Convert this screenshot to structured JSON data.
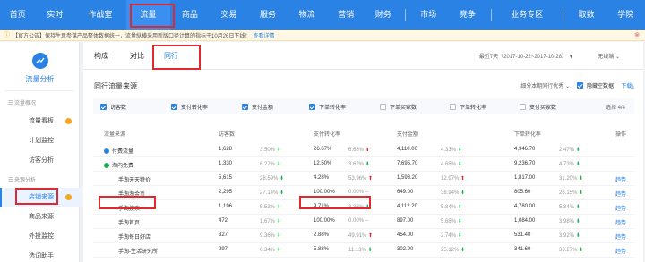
{
  "topnav": {
    "items": [
      "首页",
      "实时",
      "作战室",
      "流量",
      "商品",
      "交易",
      "服务",
      "物流",
      "营销",
      "财务",
      "市场",
      "竞争",
      "业务专区",
      "取数",
      "学院"
    ],
    "active": "流量"
  },
  "notice": {
    "icon": "warning-icon",
    "text": "【官方公告】保持生意参谋产品整体数据统一，流量纵横采用新版口径计算的指标于10月26日下线！",
    "link_label": "查看详情"
  },
  "sidebar": {
    "title": "流量分析",
    "group_overview": "流量概况",
    "items_top": [
      "流量看板",
      "计划监控",
      "访客分析"
    ],
    "group_source": "来源分析",
    "items_bottom": [
      "店铺来源",
      "商品来源",
      "外投监控",
      "选词助手"
    ],
    "active": "店铺来源"
  },
  "tabs": [
    "构成",
    "对比",
    "同行"
  ],
  "active_tab": "同行",
  "date_range": "最近7天（2017-10-22~2017-10-28）",
  "terminal": "无线端",
  "section_title": "同行流量来源",
  "column_setting": "细分本期同行优秀",
  "hide_empty_label": "隐藏空数据",
  "download_label": "下载",
  "metrics": [
    {
      "label": "访客数",
      "checked": true
    },
    {
      "label": "支付转化率",
      "checked": true
    },
    {
      "label": "支付金额",
      "checked": true
    },
    {
      "label": "下单转化率",
      "checked": true
    },
    {
      "label": "下单买家数",
      "checked": false
    },
    {
      "label": "下单转化率",
      "checked": false
    },
    {
      "label": "支付买家数",
      "checked": false
    }
  ],
  "metrics_selected": "选择 4/4",
  "table": {
    "headers": [
      "流量来源",
      "访客数",
      "支付转化率",
      "支付金额",
      "下单转化率",
      "操作"
    ],
    "rows": [
      {
        "name": "付费流量",
        "level": 0,
        "dot": "blue",
        "visitors": "1,628",
        "v_pct": "3.50%",
        "v_dir": "down",
        "conv": "26.67%",
        "c_pct": "6.68%",
        "c_dir": "up",
        "amount": "4,110.00",
        "a_pct": "4.33%",
        "a_dir": "down",
        "order": "4,946.70",
        "o_pct": "2.47%",
        "o_dir": "down",
        "action": ""
      },
      {
        "name": "淘内免费",
        "level": 0,
        "dot": "green",
        "visitors": "1,330",
        "v_pct": "6.27%",
        "v_dir": "down",
        "conv": "12.50%",
        "c_pct": "3.62%",
        "c_dir": "down",
        "amount": "7,695.70",
        "a_pct": "4.68%",
        "a_dir": "down",
        "order": "9,236.70",
        "o_pct": "4.73%",
        "o_dir": "down",
        "action": ""
      },
      {
        "name": "手淘天天特价",
        "level": 1,
        "visitors": "5,615",
        "v_pct": "28.59%",
        "v_dir": "down",
        "conv": "4.28%",
        "c_pct": "53.96%",
        "c_dir": "up",
        "amount": "1,593.20",
        "a_pct": "12.97%",
        "a_dir": "up",
        "order": "1,817.00",
        "o_pct": "31.20%",
        "o_dir": "down",
        "action": "趋势"
      },
      {
        "name": "手淘淘金币",
        "level": 1,
        "visitors": "2,295",
        "v_pct": "27.14%",
        "v_dir": "down",
        "conv": "100.00%",
        "c_pct": "0.00%",
        "c_dir": "none",
        "amount": "649.00",
        "a_pct": "38.94%",
        "a_dir": "down",
        "order": "805.60",
        "o_pct": "26.15%",
        "o_dir": "down",
        "action": "趋势"
      },
      {
        "name": "手淘搜索",
        "level": 1,
        "visitors": "1,196",
        "v_pct": "5.53%",
        "v_dir": "down",
        "conv": "9.71%",
        "c_pct": "3.38%",
        "c_dir": "down",
        "amount": "4,112.20",
        "a_pct": "5.84%",
        "a_dir": "down",
        "order": "4,780.00",
        "o_pct": "5.84%",
        "o_dir": "down",
        "action": "趋势"
      },
      {
        "name": "手淘首页",
        "level": 1,
        "visitors": "472",
        "v_pct": "1.67%",
        "v_dir": "down",
        "conv": "100.00%",
        "c_pct": "0.00%",
        "c_dir": "none",
        "amount": "897.00",
        "a_pct": "5.68%",
        "a_dir": "down",
        "order": "1,084.00",
        "o_pct": "3.98%",
        "o_dir": "down",
        "action": "趋势"
      },
      {
        "name": "手淘每日好店",
        "level": 1,
        "visitors": "327",
        "v_pct": "9.36%",
        "v_dir": "down",
        "conv": "2.88%",
        "c_pct": "49.91%",
        "c_dir": "up",
        "amount": "454.00",
        "a_pct": "2.74%",
        "a_dir": "down",
        "order": "531.40",
        "o_pct": "3.92%",
        "o_dir": "down",
        "action": "趋势"
      },
      {
        "name": "手淘-生活研究所",
        "level": 1,
        "visitors": "297",
        "v_pct": "0.34%",
        "v_dir": "down",
        "conv": "5.88%",
        "c_pct": "11.13%",
        "c_dir": "down",
        "amount": "302.90",
        "a_pct": "25.12%",
        "a_dir": "down",
        "order": "341.60",
        "o_pct": "36.27%",
        "o_dir": "down",
        "action": "趋势"
      }
    ]
  },
  "colors": {
    "accent": "#2a82e4",
    "highlight_box": "#e0292f",
    "up": "#e0292f",
    "down": "#1aad57"
  }
}
